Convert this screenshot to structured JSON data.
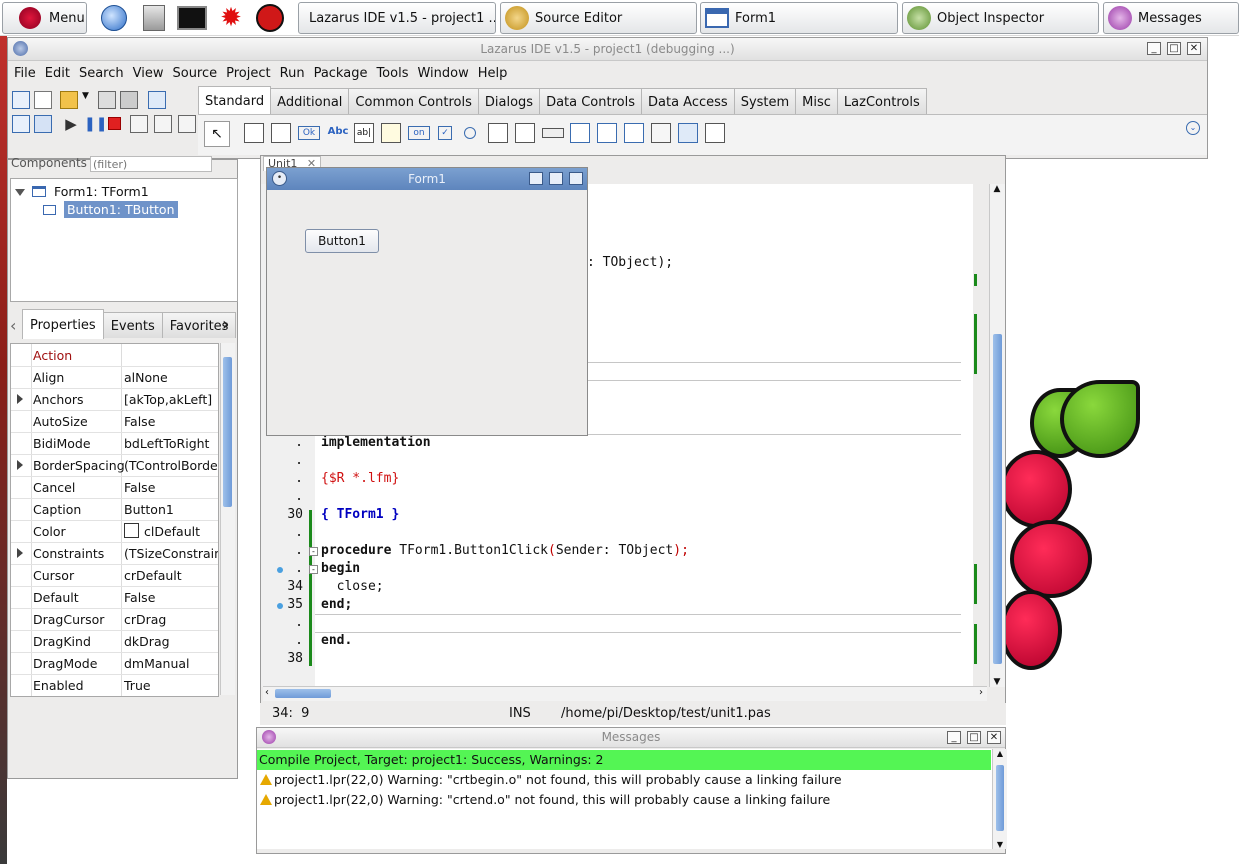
{
  "taskbar": {
    "menu_label": "Menu",
    "windows": [
      {
        "label": "Lazarus IDE v1.5 - project1 ..."
      },
      {
        "label": "Source Editor"
      },
      {
        "label": "Form1"
      },
      {
        "label": "Object Inspector"
      },
      {
        "label": "Messages"
      }
    ]
  },
  "ide": {
    "title": "Lazarus IDE v1.5 - project1 (debugging ...)",
    "menus": [
      "File",
      "Edit",
      "Search",
      "View",
      "Source",
      "Project",
      "Run",
      "Package",
      "Tools",
      "Window",
      "Help"
    ],
    "component_tabs": [
      "Standard",
      "Additional",
      "Common Controls",
      "Dialogs",
      "Data Controls",
      "Data Access",
      "System",
      "Misc",
      "LazControls"
    ],
    "active_tab": "Standard"
  },
  "object_inspector": {
    "components_label": "Components",
    "filter_placeholder": "(filter)",
    "tree": [
      "Form1: TForm1",
      "Button1: TButton"
    ],
    "tabs": [
      "Properties",
      "Events",
      "Favorites"
    ],
    "properties": [
      {
        "name": "Action",
        "value": "",
        "expandable": false,
        "highlight": true
      },
      {
        "name": "Align",
        "value": "alNone",
        "expandable": false
      },
      {
        "name": "Anchors",
        "value": "[akTop,akLeft]",
        "expandable": true
      },
      {
        "name": "AutoSize",
        "value": "False",
        "expandable": false
      },
      {
        "name": "BidiMode",
        "value": "bdLeftToRight",
        "expandable": false
      },
      {
        "name": "BorderSpacing",
        "value": "(TControlBorderS",
        "expandable": true
      },
      {
        "name": "Cancel",
        "value": "False",
        "expandable": false
      },
      {
        "name": "Caption",
        "value": "Button1",
        "expandable": false
      },
      {
        "name": "Color",
        "value": "clDefault",
        "expandable": false,
        "swatch": true
      },
      {
        "name": "Constraints",
        "value": "(TSizeConstraint",
        "expandable": true
      },
      {
        "name": "Cursor",
        "value": "crDefault",
        "expandable": false
      },
      {
        "name": "Default",
        "value": "False",
        "expandable": false
      },
      {
        "name": "DragCursor",
        "value": "crDrag",
        "expandable": false
      },
      {
        "name": "DragKind",
        "value": "dkDrag",
        "expandable": false
      },
      {
        "name": "DragMode",
        "value": "dmManual",
        "expandable": false
      },
      {
        "name": "Enabled",
        "value": "True",
        "expandable": false
      }
    ]
  },
  "editor": {
    "tab_label": "Unit1",
    "visible_line_fragment": ": TObject);",
    "lines": [
      {
        "num": ".",
        "text": "implementation",
        "style": "kw"
      },
      {
        "num": ".",
        "text": "",
        "style": ""
      },
      {
        "num": ".",
        "text": "{$R *.lfm}",
        "style": "dir"
      },
      {
        "num": ".",
        "text": "",
        "style": ""
      },
      {
        "num": "30",
        "text": "{ TForm1 }",
        "style": "cmt"
      },
      {
        "num": ".",
        "text": "",
        "style": ""
      },
      {
        "num": ".",
        "text": "procedure TForm1.Button1Click(Sender: TObject);",
        "style": "proc"
      },
      {
        "num": ".",
        "text": "begin",
        "style": "kw"
      },
      {
        "num": "34",
        "text": "  close;",
        "style": "plain"
      },
      {
        "num": "35",
        "text": "end;",
        "style": "kw"
      },
      {
        "num": ".",
        "text": "",
        "style": ""
      },
      {
        "num": ".",
        "text": "end.",
        "style": "kw"
      },
      {
        "num": "38",
        "text": "",
        "style": ""
      }
    ]
  },
  "form1": {
    "title": "Form1",
    "button_caption": "Button1"
  },
  "statusbar": {
    "position": "34:  9",
    "mode": "INS",
    "file": "/home/pi/Desktop/test/unit1.pas"
  },
  "messages": {
    "title": "Messages",
    "lines": [
      {
        "text": "Compile Project, Target: project1: Success, Warnings: 2",
        "kind": "success"
      },
      {
        "text": "project1.lpr(22,0) Warning: \"crtbegin.o\" not found, this will probably cause a linking failure",
        "kind": "warning"
      },
      {
        "text": "project1.lpr(22,0) Warning: \"crtend.o\" not found, this will probably cause a linking failure",
        "kind": "warning"
      }
    ]
  },
  "colors": {
    "success_bg": "#54f554",
    "selection_bg": "#6f93c9",
    "form_title": "#6a8fc6",
    "modified_bar": "#1b8a1b"
  }
}
